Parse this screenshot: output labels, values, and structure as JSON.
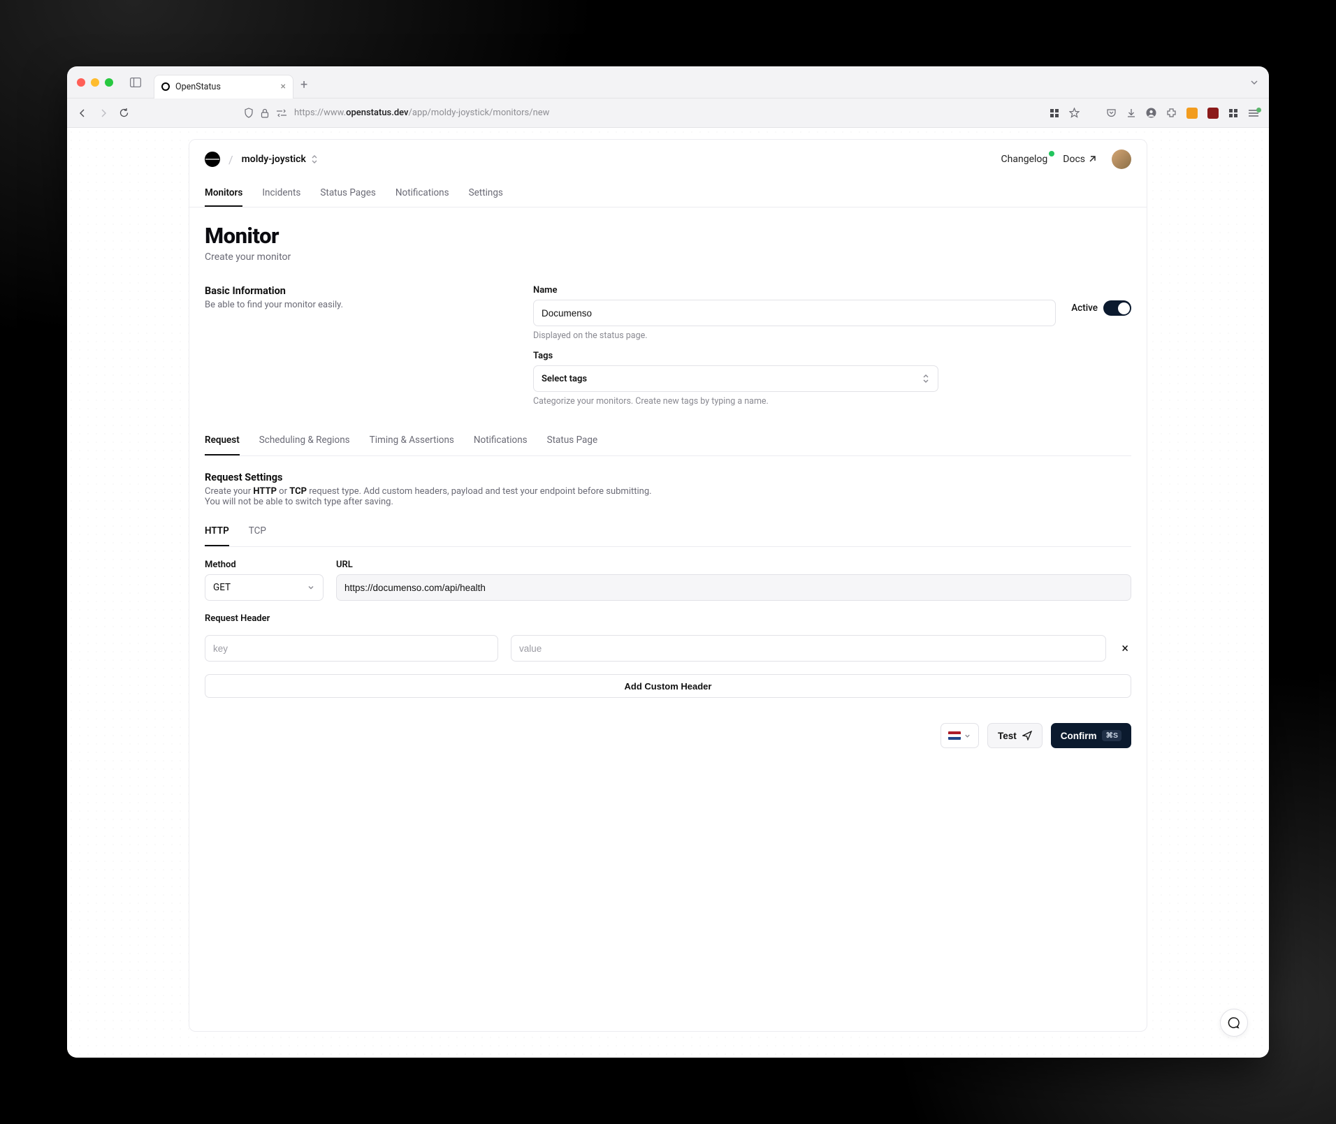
{
  "browser": {
    "tab_title": "OpenStatus",
    "url_prefix": "https://www.",
    "url_host": "openstatus.dev",
    "url_path": "/app/moldy-joystick/monitors/new"
  },
  "header": {
    "workspace": "moldy-joystick",
    "changelog": "Changelog",
    "docs": "Docs"
  },
  "nav": [
    "Monitors",
    "Incidents",
    "Status Pages",
    "Notifications",
    "Settings"
  ],
  "nav_active": 0,
  "page": {
    "title": "Monitor",
    "subtitle": "Create your monitor"
  },
  "basic": {
    "section_title": "Basic Information",
    "section_desc": "Be able to find your monitor easily.",
    "name_label": "Name",
    "name_value": "Documenso",
    "name_helper": "Displayed on the status page.",
    "active_label": "Active",
    "tags_label": "Tags",
    "tags_placeholder": "Select tags",
    "tags_helper": "Categorize your monitors. Create new tags by typing a name."
  },
  "inner_tabs": [
    "Request",
    "Scheduling & Regions",
    "Timing & Assertions",
    "Notifications",
    "Status Page"
  ],
  "inner_active": 0,
  "request": {
    "section_title": "Request Settings",
    "desc_1": "Create your ",
    "desc_http": "HTTP",
    "desc_or": " or ",
    "desc_tcp": "TCP",
    "desc_2": " request type. Add custom headers, payload and test your endpoint before submitting. You will not be able to switch type after saving.",
    "proto_tabs": [
      "HTTP",
      "TCP"
    ],
    "proto_active": 0,
    "method_label": "Method",
    "method_value": "GET",
    "url_label": "URL",
    "url_value": "https://documenso.com/api/health",
    "header_label": "Request Header",
    "header_key_placeholder": "key",
    "header_value_placeholder": "value",
    "add_header": "Add Custom Header"
  },
  "footer": {
    "test": "Test",
    "confirm": "Confirm",
    "shortcut": "⌘S"
  }
}
